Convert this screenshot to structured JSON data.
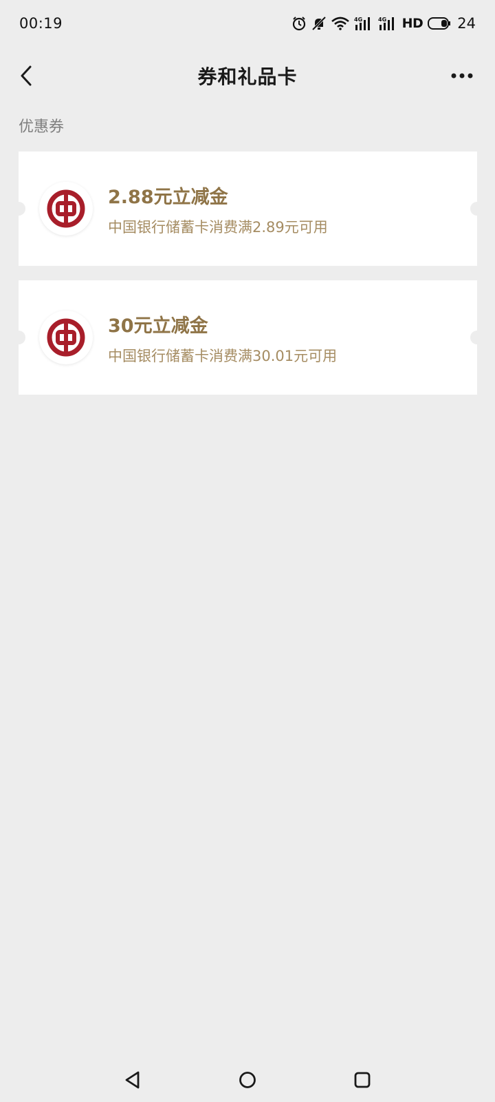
{
  "status_bar": {
    "time": "00:19",
    "hd_label": "HD",
    "battery": "24",
    "icons": [
      "alarm-icon",
      "mute-icon",
      "wifi-icon",
      "signal-4g-icon",
      "signal-4g-icon",
      "hd-icon",
      "battery-icon"
    ]
  },
  "header": {
    "title": "券和礼品卡",
    "back_icon": "chevron-left-icon",
    "more_icon": "more-dots-icon"
  },
  "section": {
    "label": "优惠券"
  },
  "coupons": [
    {
      "title": "2.88元立减金",
      "desc": "中国银行储蓄卡消费满2.89元可用",
      "logo": "bank-of-china-logo"
    },
    {
      "title": "30元立减金",
      "desc": "中国银行储蓄卡消费满30.01元可用",
      "logo": "bank-of-china-logo"
    }
  ],
  "colors": {
    "background": "#ededed",
    "card": "#ffffff",
    "coupon_title": "#8f7447",
    "coupon_desc": "#a58c62",
    "logo_red": "#a81e2a"
  },
  "nav": {
    "icons": [
      "back-triangle-icon",
      "home-circle-icon",
      "recents-square-icon"
    ]
  }
}
